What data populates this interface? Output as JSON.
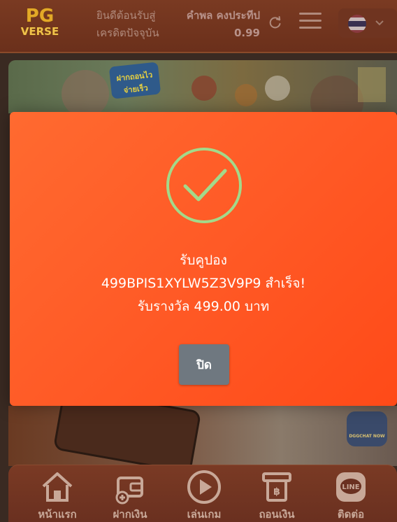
{
  "header": {
    "logo_line1": "PG",
    "logo_line2": "VERSE",
    "welcome_line1": "ยินดีต้อนรับสู่",
    "welcome_line2": "เครดิตปัจจุบัน",
    "username": "คำพล คงประทีป",
    "credit": "0.99",
    "refresh_icon": "refresh-icon",
    "menu_icon": "hamburger-menu-icon",
    "language_flag": "thailand-flag-icon",
    "flag_colors": [
      "#a51931",
      "#f4f5f8",
      "#2d2a4a",
      "#2d2a4a",
      "#f4f5f8",
      "#a51931"
    ]
  },
  "banner": {
    "badge_text": "ฝากถอนไว จ่ายเร็ว"
  },
  "dg_chat": {
    "label": "DGGCHAT NOW"
  },
  "modal": {
    "line1": "รับคูปอง",
    "line2": "499BPIS1XYLW5Z3V9P9 สำเร็จ!",
    "line3": "รับรางวัล 499.00 บาท",
    "close_label": "ปิด",
    "success_color": "#a3d98a",
    "background_color": "#ff5a26"
  },
  "bottom_nav": {
    "items": [
      {
        "label": "หน้าแรก",
        "icon": "home-icon"
      },
      {
        "label": "ฝากเงิน",
        "icon": "deposit-wallet-icon"
      },
      {
        "label": "เล่นเกม",
        "icon": "play-icon"
      },
      {
        "label": "ถอนเงิน",
        "icon": "withdraw-atm-icon"
      },
      {
        "label": "ติดต่อ",
        "icon": "line-chat-icon"
      }
    ]
  }
}
